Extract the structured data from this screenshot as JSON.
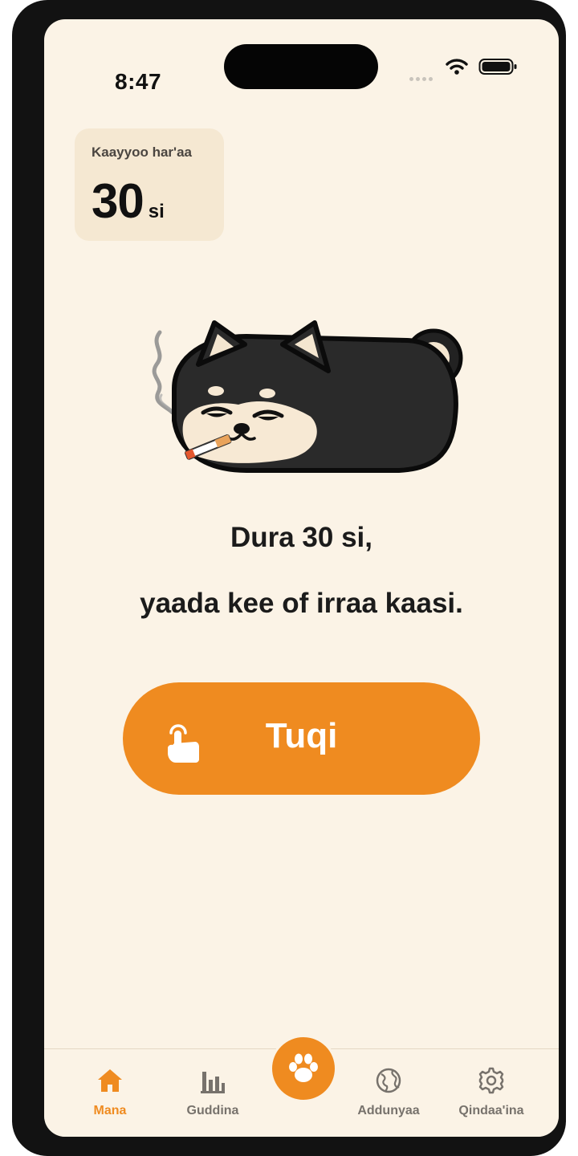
{
  "status_bar": {
    "time": "8:47",
    "icons": [
      "cellular-dots-icon",
      "wifi-icon",
      "battery-icon"
    ]
  },
  "streak": {
    "label": "Kaayyoo har'aa",
    "value": "30",
    "unit": "si"
  },
  "illustration": {
    "subject": "black-shiba-dog-smoking-icon"
  },
  "message": {
    "line1": "Dura 30 si,",
    "line2": "yaada kee of irraa kaasi."
  },
  "primary_button": {
    "label": "Tuqi",
    "icon": "tap-finger-icon"
  },
  "tabbar": {
    "items": [
      {
        "label": "Mana",
        "icon": "home-icon",
        "active": true
      },
      {
        "label": "Guddina",
        "icon": "bar-chart-icon",
        "active": false
      },
      {
        "label": "",
        "icon": "paw-icon",
        "active": false
      },
      {
        "label": "Addunyaa",
        "icon": "globe-icon",
        "active": false
      },
      {
        "label": "Qindaa'ina",
        "icon": "gear-icon",
        "active": false
      }
    ]
  },
  "colors": {
    "background": "#fbf3e6",
    "accent": "#ef8b20",
    "card": "#f5e8d2",
    "text": "#1b1b1b",
    "inactive": "#77726c"
  }
}
